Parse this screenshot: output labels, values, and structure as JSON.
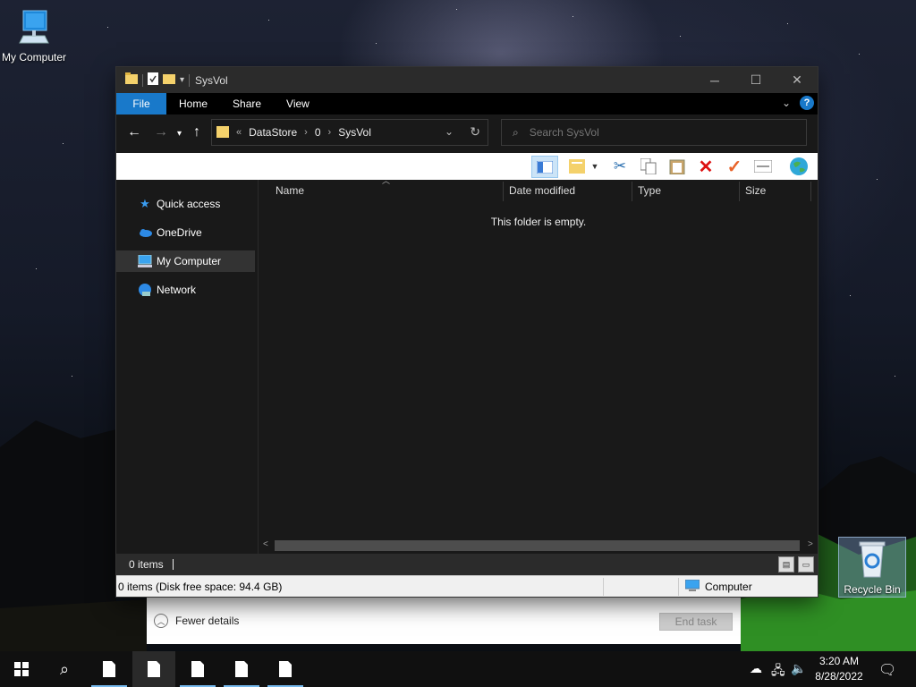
{
  "desktop": {
    "icons": [
      {
        "label": "My Computer"
      },
      {
        "label": "Recycle Bin"
      }
    ]
  },
  "window": {
    "title": "SysVol",
    "controls": {
      "minimize": "─",
      "maximize": "☐",
      "close": "✕"
    }
  },
  "ribbon": {
    "tabs": [
      "File",
      "Home",
      "Share",
      "View"
    ]
  },
  "address": {
    "crumbs": [
      "DataStore",
      "0",
      "SysVol"
    ],
    "overflow": "«"
  },
  "search": {
    "placeholder": "Search SysVol"
  },
  "sidebar": {
    "items": [
      {
        "label": "Quick access",
        "icon": "star-icon"
      },
      {
        "label": "OneDrive",
        "icon": "cloud-icon"
      },
      {
        "label": "My Computer",
        "icon": "computer-icon",
        "selected": true
      },
      {
        "label": "Network",
        "icon": "network-icon"
      }
    ]
  },
  "columns": [
    "Name",
    "Date modified",
    "Type",
    "Size"
  ],
  "content": {
    "empty_message": "This folder is empty."
  },
  "status": {
    "count": "0 items"
  },
  "legacy_status": {
    "info": "0 items (Disk free space: 94.4 GB)",
    "zone": "Computer"
  },
  "task_manager": {
    "fewer_details": "Fewer details",
    "end_task": "End task"
  },
  "taskbar": {
    "time": "3:20 AM",
    "date": "8/28/2022"
  },
  "colors": {
    "accent": "#1979ca",
    "window_bg": "#191919",
    "titlebar": "#2b2b2b"
  }
}
